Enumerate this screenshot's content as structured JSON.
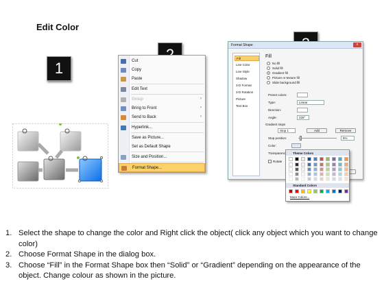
{
  "title": "Edit Color",
  "badges": [
    "1",
    "2",
    "3"
  ],
  "context_menu": {
    "items": [
      {
        "label": "Cut",
        "icon": "scissors-icon",
        "color": "#4a6fa5"
      },
      {
        "label": "Copy",
        "icon": "copy-icon",
        "color": "#6a8bc5"
      },
      {
        "label": "Paste",
        "icon": "paste-icon",
        "color": "#c69a4a"
      },
      {
        "label": "Edit Text",
        "icon": "edit-text-icon",
        "color": "#7a8aa0"
      },
      {
        "label": "Group",
        "icon": "group-icon",
        "color": "#b0b0b0",
        "disabled": true,
        "submenu": true
      },
      {
        "label": "Bring to Front",
        "icon": "bring-front-icon",
        "color": "#6c8fc6",
        "submenu": true
      },
      {
        "label": "Send to Back",
        "icon": "send-back-icon",
        "color": "#d38b3c",
        "submenu": true
      },
      {
        "label": "Hyperlink...",
        "icon": "hyperlink-icon",
        "color": "#3a7ab8"
      },
      {
        "label": "Save as Picture...",
        "icon": "",
        "color": ""
      },
      {
        "label": "Set as Default Shape",
        "icon": "",
        "color": ""
      },
      {
        "label": "Size and Position...",
        "icon": "size-position-icon",
        "color": "#8aa0c0"
      },
      {
        "label": "Format Shape...",
        "icon": "format-shape-icon",
        "color": "#c87a3a",
        "highlight": true
      }
    ]
  },
  "dialog": {
    "title": "Format Shape",
    "close": "x",
    "nav": [
      "Fill",
      "Line Color",
      "Line Style",
      "Shadow",
      "3-D Format",
      "3-D Rotation",
      "Picture",
      "Text Box"
    ],
    "heading": "Fill",
    "fill_options": [
      "No fill",
      "Solid fill",
      "Gradient fill",
      "Picture or texture fill",
      "Slide background fill"
    ],
    "selected_fill": "Gradient fill",
    "preset_colors_label": "Preset colors:",
    "type_label": "Type:",
    "type_value": "Linear",
    "direction_label": "Direction:",
    "angle_label": "Angle:",
    "angle_value": "225°",
    "gradient_stops_label": "Gradient stops",
    "stop_value": "Stop 1",
    "add_button": "Add",
    "remove_button": "Remove",
    "stop_position_label": "Stop position:",
    "stop_position_value": "5%",
    "color_label": "Color:",
    "transparency_label": "Transparency:",
    "rotate_label": "Rotate",
    "close_button": "se"
  },
  "color_picker": {
    "theme_header": "Theme Colors",
    "standard_header": "Standard Colors",
    "more_colors": "More Colors...",
    "theme_colors": [
      "#ffffff",
      "#000000",
      "#eeece1",
      "#1f497d",
      "#4f81bd",
      "#c0504d",
      "#9bbb59",
      "#8064a2",
      "#4bacc6",
      "#f79646"
    ],
    "standard_colors": [
      "#c00000",
      "#ff0000",
      "#ffc000",
      "#ffff00",
      "#92d050",
      "#00b050",
      "#00b0f0",
      "#0070c0",
      "#002060",
      "#7030a0"
    ]
  },
  "instructions": [
    {
      "num": "1.",
      "text": "Select the shape to change the color and Right click the object( click any object which you want to change color)"
    },
    {
      "num": "2.",
      "text": "Choose Format Shape in the dialog box."
    },
    {
      "num": "3.",
      "text": "Choose “Fill” in the Format Shape box then “Solid” or “Gradient” depending on the appearance of the object. Change colour as shown in the picture."
    }
  ]
}
